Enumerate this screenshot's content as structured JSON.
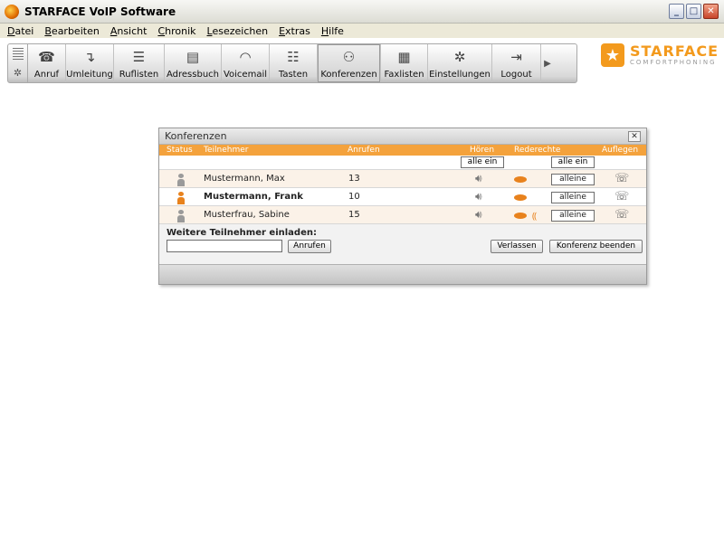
{
  "window": {
    "title": "STARFACE VoIP Software"
  },
  "menu": [
    "Datei",
    "Bearbeiten",
    "Ansicht",
    "Chronik",
    "Lesezeichen",
    "Extras",
    "Hilfe"
  ],
  "toolbar": {
    "items": [
      {
        "label": "Anruf",
        "icon": "phone-icon",
        "glyph": "☎"
      },
      {
        "label": "Umleitung",
        "icon": "redirect-icon",
        "glyph": "↴"
      },
      {
        "label": "Ruflisten",
        "icon": "list-icon",
        "glyph": "☰"
      },
      {
        "label": "Adressbuch",
        "icon": "addressbook-icon",
        "glyph": "▤"
      },
      {
        "label": "Voicemail",
        "icon": "voicemail-icon",
        "glyph": "◠"
      },
      {
        "label": "Tasten",
        "icon": "keys-icon",
        "glyph": "☷"
      },
      {
        "label": "Konferenzen",
        "icon": "conference-icon",
        "glyph": "⚇"
      },
      {
        "label": "Faxlisten",
        "icon": "fax-icon",
        "glyph": "▦"
      },
      {
        "label": "Einstellungen",
        "icon": "gear-icon",
        "glyph": "✲"
      },
      {
        "label": "Logout",
        "icon": "logout-icon",
        "glyph": "⇥"
      }
    ],
    "active": "Konferenzen"
  },
  "logo": {
    "name": "STARFACE",
    "tagline": "COMFORTPHONING"
  },
  "dialog": {
    "title": "Konferenzen",
    "columns": {
      "status": "Status",
      "participant": "Teilnehmer",
      "calls": "Anrufen",
      "hear": "Hören",
      "speak": "Rederechte",
      "hangup": "Auflegen"
    },
    "all_on_hear": "alle ein",
    "all_on_speak": "alle ein",
    "rows": [
      {
        "name": "Mustermann, Max",
        "calls": "13",
        "speak_label": "alleine",
        "bold": false,
        "status_color": "#9a9a9a",
        "speaking": false
      },
      {
        "name": "Mustermann, Frank",
        "calls": "10",
        "speak_label": "alleine",
        "bold": true,
        "status_color": "#e8821d",
        "speaking": false
      },
      {
        "name": "Musterfrau, Sabine",
        "calls": "15",
        "speak_label": "alleine",
        "bold": false,
        "status_color": "#9a9a9a",
        "speaking": true
      }
    ],
    "invite_label": "Weitere Teilnehmer einladen:",
    "invite_value": "",
    "call_button": "Anrufen",
    "leave_button": "Verlassen",
    "end_button": "Konferenz beenden"
  }
}
